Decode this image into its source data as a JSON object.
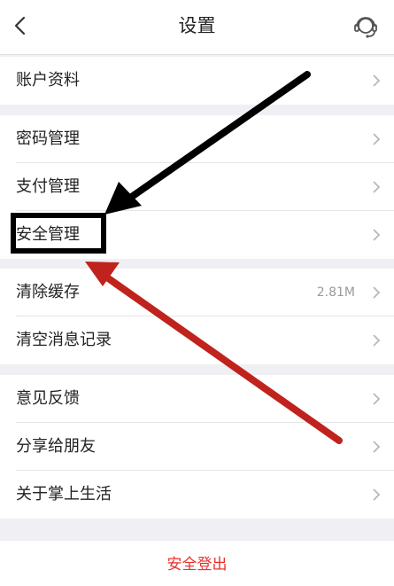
{
  "header": {
    "title": "设置",
    "back_icon": "chevron-left-icon",
    "service_icon": "customer-service-headset-icon"
  },
  "settings": {
    "account_profile": {
      "label": "账户资料"
    },
    "password_manage": {
      "label": "密码管理"
    },
    "payment_manage": {
      "label": "支付管理"
    },
    "security_manage": {
      "label": "安全管理"
    },
    "clear_cache": {
      "label": "清除缓存",
      "value": "2.81M"
    },
    "clear_messages": {
      "label": "清空消息记录"
    },
    "feedback": {
      "label": "意见反馈"
    },
    "share_friends": {
      "label": "分享给朋友"
    },
    "about": {
      "label": "关于掌上生活"
    }
  },
  "logout": {
    "label": "安全登出"
  },
  "colors": {
    "page_background": "#efeff4",
    "logout_red": "#e5332c",
    "annotation_black": "#000000",
    "annotation_red": "#c0221e"
  }
}
